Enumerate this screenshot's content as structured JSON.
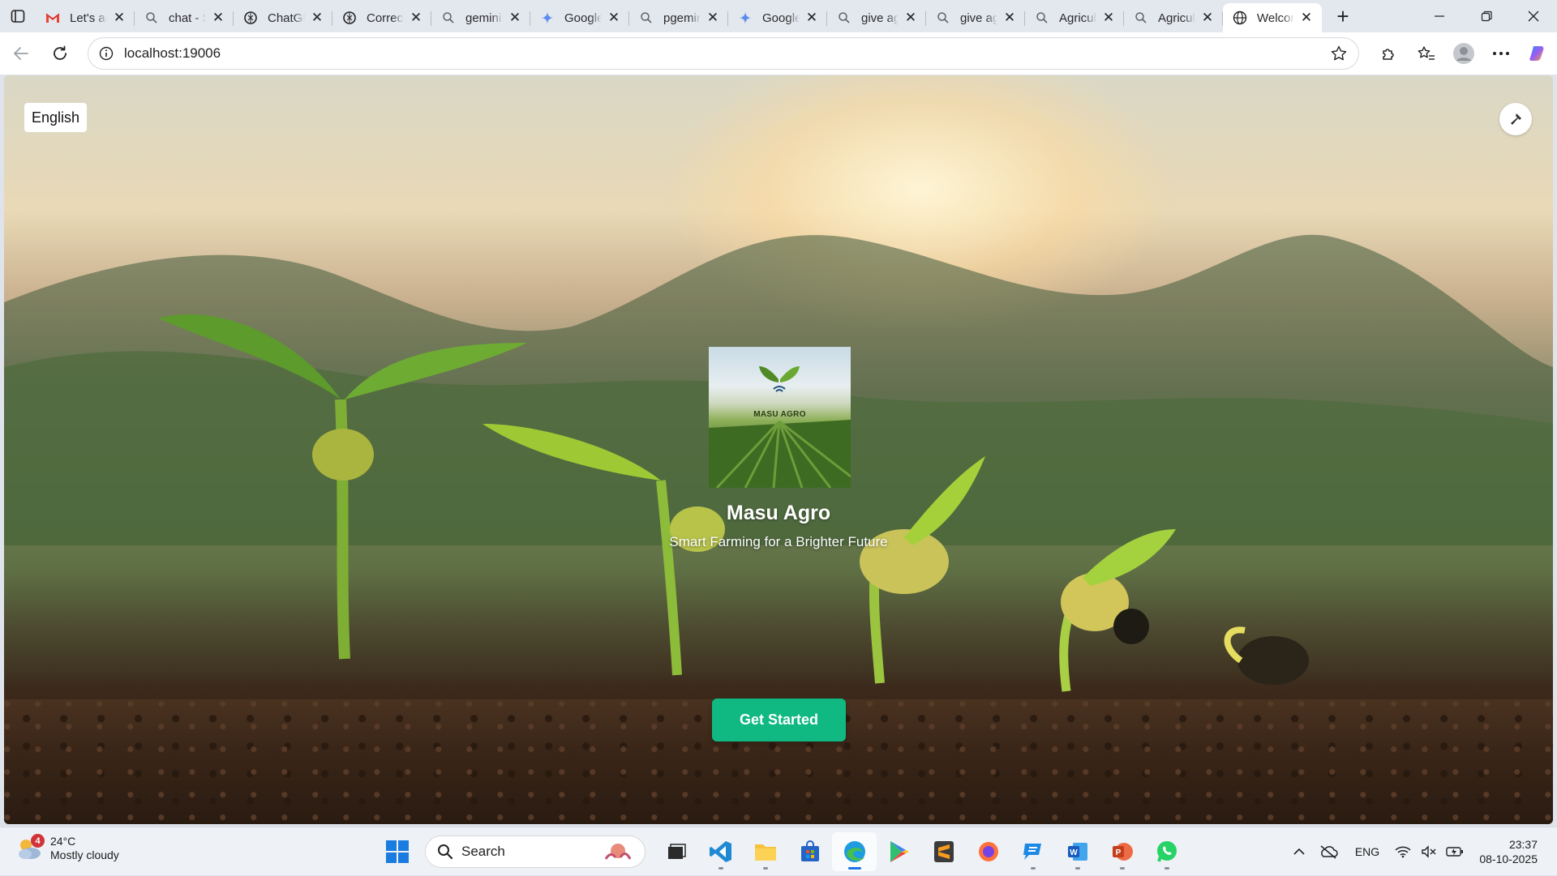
{
  "browser": {
    "tabs": [
      {
        "title": "Let's ac",
        "icon": "gmail-icon",
        "active": false
      },
      {
        "title": "chat - S",
        "icon": "search-icon",
        "active": false
      },
      {
        "title": "ChatGPT",
        "icon": "chatgpt-icon",
        "active": false
      },
      {
        "title": "Correct",
        "icon": "chatgpt-icon",
        "active": false
      },
      {
        "title": "gemini",
        "icon": "search-icon",
        "active": false
      },
      {
        "title": "Google",
        "icon": "gemini-icon",
        "active": false
      },
      {
        "title": "pgemini",
        "icon": "search-icon",
        "active": false
      },
      {
        "title": "Google",
        "icon": "gemini-icon",
        "active": false
      },
      {
        "title": "give ag",
        "icon": "search-icon",
        "active": false
      },
      {
        "title": "give ag",
        "icon": "search-icon",
        "active": false
      },
      {
        "title": "Agricul",
        "icon": "search-icon",
        "active": false
      },
      {
        "title": "Agricul",
        "icon": "search-icon",
        "active": false
      },
      {
        "title": "Welcome",
        "icon": "globe-icon",
        "active": true
      }
    ],
    "url": "localhost:19006"
  },
  "page": {
    "language_button": "English",
    "logo_text": "MASU AGRO",
    "app_name": "Masu Agro",
    "tagline": "Smart Farming for a Brighter Future",
    "cta_label": "Get Started",
    "accent_color": "#10b981"
  },
  "taskbar": {
    "weather": {
      "badge": "4",
      "temp": "24°C",
      "condition": "Mostly cloudy"
    },
    "search_label": "Search",
    "tray_language": "ENG",
    "time": "23:37",
    "date": "08-10-2025"
  }
}
